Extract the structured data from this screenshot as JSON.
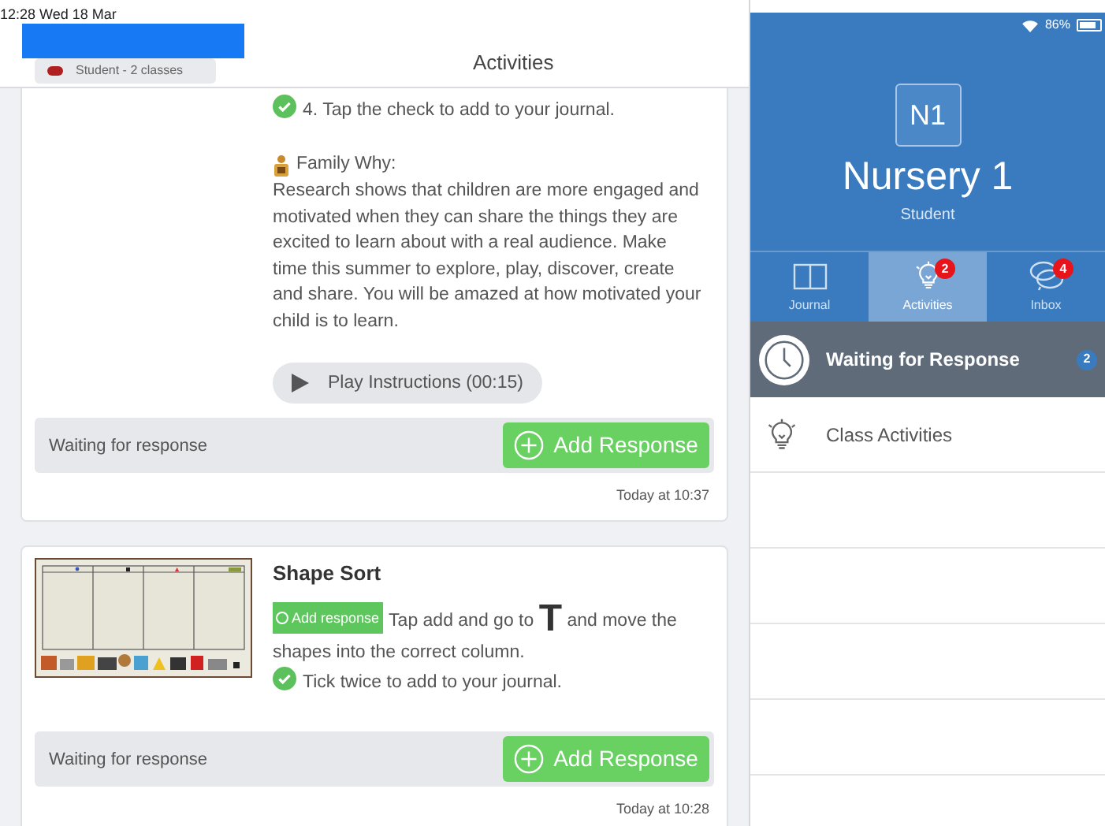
{
  "status_bar": {
    "time": "12:28",
    "date": "Wed 18 Mar",
    "battery": "86%"
  },
  "header": {
    "account_subtitle": "Student - 2 classes",
    "title": "Activities"
  },
  "activities": [
    {
      "has_image": false,
      "blocks": [
        {
          "kind": "check",
          "text": "4. Tap the check to add to your journal."
        },
        {
          "kind": "family",
          "text": "Family Why:"
        },
        {
          "kind": "paragraph",
          "text": "Research shows that children are more engaged and motivated when they can share the things they are excited to learn about with a real audience. Make time this summer to explore, play, discover, create and share. You will be amazed at how motivated your child is to learn."
        },
        {
          "kind": "play",
          "text": "Play Instructions (00:15)"
        }
      ],
      "status": "Waiting for response",
      "button": "Add Response",
      "time": "Today at 10:37"
    },
    {
      "has_image": true,
      "title": "Shape Sort",
      "blocks": [
        {
          "kind": "badge_line",
          "badge": "Add response",
          "before": "Tap add and go to",
          "symbol": "T",
          "after": "and move the shapes into the correct column."
        },
        {
          "kind": "check",
          "text": "Tick twice to add to your journal."
        }
      ],
      "status": "Waiting for response",
      "button": "Add Response",
      "time": "Today at 10:28"
    }
  ],
  "sidebar": {
    "class_code": "N1",
    "class_name": "Nursery 1",
    "role": "Student",
    "tabs": [
      {
        "label": "Journal",
        "selected": false,
        "kind": "journal"
      },
      {
        "label": "Activities",
        "selected": true,
        "kind": "activities",
        "badge": "2"
      },
      {
        "label": "Inbox",
        "selected": false,
        "kind": "inbox",
        "badge": "4"
      }
    ],
    "items": [
      {
        "label": "Waiting for Response",
        "selected": true,
        "kind": "clock",
        "count": "2"
      },
      {
        "label": "Class Activities",
        "selected": false,
        "kind": "bulb"
      }
    ]
  }
}
